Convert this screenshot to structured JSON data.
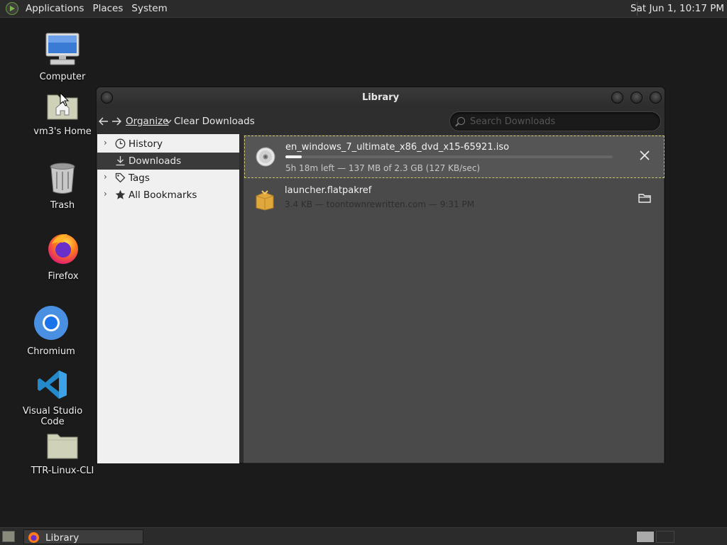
{
  "top_panel": {
    "menus": [
      "Applications",
      "Places",
      "System"
    ],
    "clock": "Sat Jun  1, 10:17 PM"
  },
  "desktop": {
    "icons": [
      {
        "label": "Computer",
        "icon": "computer-icon"
      },
      {
        "label": "vm3's Home",
        "icon": "home-folder-icon"
      },
      {
        "label": "Trash",
        "icon": "trash-icon"
      },
      {
        "label": "Firefox",
        "icon": "firefox-icon"
      },
      {
        "label": "Chromium",
        "icon": "chromium-icon"
      },
      {
        "label": "Visual Studio Code",
        "icon": "vscode-icon"
      },
      {
        "label": "TTR-Linux-CLI",
        "icon": "folder-icon"
      }
    ]
  },
  "window": {
    "title": "Library",
    "toolbar": {
      "organize": "Organize",
      "clear_downloads": "Clear Downloads",
      "search_placeholder": "Search Downloads"
    },
    "sidebar": [
      {
        "label": "History",
        "icon": "clock-icon",
        "expandable": true
      },
      {
        "label": "Downloads",
        "icon": "download-icon",
        "selected": true
      },
      {
        "label": "Tags",
        "icon": "tag-icon",
        "expandable": true
      },
      {
        "label": "All Bookmarks",
        "icon": "star-icon",
        "expandable": true
      }
    ],
    "downloads": [
      {
        "name": "en_windows_7_ultimate_x86_dvd_x15-65921.iso",
        "status": "5h 18m left — 137 MB of 2.3 GB (127 KB/sec)",
        "progress_percent": 5,
        "icon": "disc-icon",
        "action": "cancel"
      },
      {
        "name": "launcher.flatpakref",
        "status": "3.4 KB — toontownrewritten.com — 9:31 PM",
        "icon": "package-icon",
        "action": "open-folder"
      }
    ]
  },
  "taskbar": {
    "task_label": "Library"
  },
  "colors": {
    "panel": "#2b2b2b",
    "desktop": "#1b1b1b",
    "selection_border": "#c9c36a"
  }
}
